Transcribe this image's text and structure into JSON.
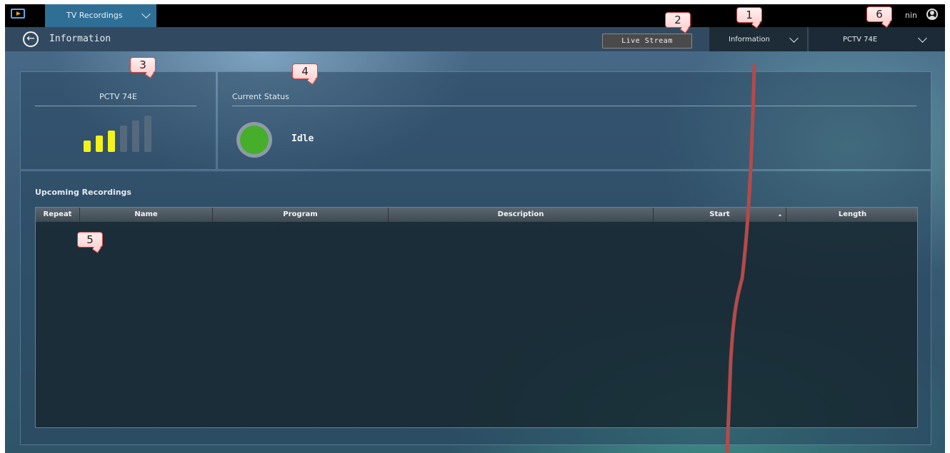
{
  "topbar": {
    "app_tab_label": "TV Recordings",
    "user_label": "nin"
  },
  "navbar": {
    "page_title": "Information",
    "live_stream_label": "Live Stream",
    "view_dropdown_label": "Information",
    "device_dropdown_label": "PCTV 74E"
  },
  "device_panel": {
    "device_name": "PCTV 74E",
    "signal_level": 3,
    "signal_max": 6
  },
  "status_panel": {
    "title": "Current Status",
    "status": "Idle"
  },
  "recordings": {
    "title": "Upcoming Recordings",
    "columns": [
      "Repeat",
      "Name",
      "Program",
      "Description",
      "Start",
      "Length"
    ],
    "rows": []
  },
  "annotations": [
    "1",
    "2",
    "3",
    "4",
    "5",
    "6"
  ],
  "colors": {
    "accent": "#2f6f96",
    "signal_active": "#f4f21a",
    "signal_inactive": "#55697d",
    "status_idle": "#46ae2a",
    "callout_border": "#d84040",
    "arrow": "#b44a4a"
  },
  "icons": [
    "app-icon",
    "chevron-down-icon",
    "user-icon",
    "back-arrow-icon",
    "sort-ascending-icon"
  ]
}
